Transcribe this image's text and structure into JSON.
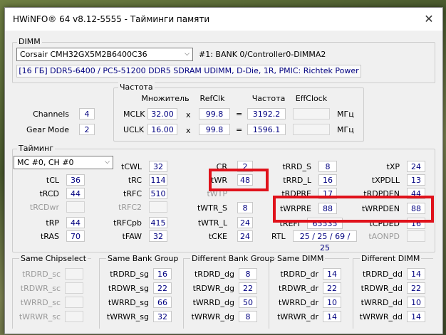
{
  "window": {
    "title": "HWiNFO® 64 v8.12-5555 - Тайминги памяти",
    "close_label": "✕"
  },
  "dimm": {
    "group_label": "DIMM",
    "module": "Corsair CMH32GX5M2B6400C36",
    "slot": "#1: BANK 0/Controller0-DIMMA2",
    "info": "[16 ГБ] DDR5-6400 / PC5-51200 DDR5 SDRAM UDIMM, D-Die, 1R, PMIC: Richtek Power"
  },
  "left_info": {
    "channels_label": "Channels",
    "channels_value": "4",
    "gear_label": "Gear Mode",
    "gear_value": "2"
  },
  "freq": {
    "group_label": "Частота",
    "headers": {
      "multiplier": "Множитель",
      "refclk": "RefClk",
      "freq": "Частота",
      "effclock": "EffClock"
    },
    "mclk": {
      "label": "MCLK",
      "mult": "32.00",
      "x": "x",
      "refclk": "99.8",
      "eq": "=",
      "value": "3192.2",
      "eff": "",
      "unit": "МГц"
    },
    "uclk": {
      "label": "UCLK",
      "mult": "16.00",
      "x": "x",
      "refclk": "99.8",
      "eq": "=",
      "value": "1596.1",
      "eff": "",
      "unit": "МГц"
    }
  },
  "timing": {
    "group_label": "Тайминг",
    "channel_select": "MC #0, CH #0",
    "tCL": {
      "label": "tCL",
      "value": "36"
    },
    "tRCD": {
      "label": "tRCD",
      "value": "44"
    },
    "tRCDwr": {
      "label": "tRCDwr",
      "value": ""
    },
    "tRP": {
      "label": "tRP",
      "value": "44"
    },
    "tRAS": {
      "label": "tRAS",
      "value": "70"
    },
    "tCWL": {
      "label": "tCWL",
      "value": "32"
    },
    "tRC": {
      "label": "tRC",
      "value": "114"
    },
    "tRFC": {
      "label": "tRFC",
      "value": "510"
    },
    "tRFC2": {
      "label": "tRFC2",
      "value": ""
    },
    "tRFCpb": {
      "label": "tRFCpb",
      "value": "415"
    },
    "tFAW": {
      "label": "tFAW",
      "value": "32"
    },
    "CR": {
      "label": "CR",
      "value": "2"
    },
    "tWR": {
      "label": "tWR",
      "value": "48"
    },
    "tWTP": {
      "label": "tWTP"
    },
    "tWTR_S": {
      "label": "tWTR_S",
      "value": "8"
    },
    "tWTR_L": {
      "label": "tWTR_L",
      "value": "24"
    },
    "tCKE": {
      "label": "tCKE",
      "value": "24"
    },
    "tRRD_S": {
      "label": "tRRD_S",
      "value": "8"
    },
    "tRRD_L": {
      "label": "tRRD_L",
      "value": "16"
    },
    "tRDPRE": {
      "label": "tRDPRE",
      "value": "17"
    },
    "tWRPRE": {
      "label": "tWRPRE",
      "value": "88"
    },
    "tREFI": {
      "label": "tREFI",
      "value": "65535"
    },
    "RTL": {
      "label": "RTL",
      "value": "25 / 25 / 69 / 25"
    },
    "tXP": {
      "label": "tXP",
      "value": "24"
    },
    "tXPDLL": {
      "label": "tXPDLL",
      "value": "13"
    },
    "tRDPDEN": {
      "label": "tRDPDEN",
      "value": "44"
    },
    "tWRPDEN": {
      "label": "tWRPDEN",
      "value": "88"
    },
    "tCPDED": {
      "label": "tCPDED",
      "value": "16"
    },
    "tAONPD": {
      "label": "tAONPD",
      "value": ""
    }
  },
  "sections": [
    {
      "title": "Same Chipselect",
      "rows": [
        {
          "label": "tRDRD_sc",
          "value": ""
        },
        {
          "label": "tRDWR_sc",
          "value": ""
        },
        {
          "label": "tWRRD_sc",
          "value": ""
        },
        {
          "label": "tWRWR_sc",
          "value": ""
        }
      ]
    },
    {
      "title": "Same Bank Group",
      "rows": [
        {
          "label": "tRDRD_sg",
          "value": "16"
        },
        {
          "label": "tRDWR_sg",
          "value": "22"
        },
        {
          "label": "tWRRD_sg",
          "value": "66"
        },
        {
          "label": "tWRWR_sg",
          "value": "32"
        }
      ]
    },
    {
      "title": "Different Bank Group",
      "rows": [
        {
          "label": "tRDRD_dg",
          "value": "8"
        },
        {
          "label": "tRDWR_dg",
          "value": "22"
        },
        {
          "label": "tWRRD_dg",
          "value": "50"
        },
        {
          "label": "tWRWR_dg",
          "value": "8"
        }
      ]
    },
    {
      "title": "Same DIMM",
      "rows": [
        {
          "label": "tRDRD_dr",
          "value": "14"
        },
        {
          "label": "tRDWR_dr",
          "value": "22"
        },
        {
          "label": "tWRRD_dr",
          "value": "10"
        },
        {
          "label": "tWRWR_dr",
          "value": "14"
        }
      ]
    },
    {
      "title": "Different DIMM",
      "rows": [
        {
          "label": "tRDRD_dd",
          "value": "14"
        },
        {
          "label": "tRDWR_dd",
          "value": "22"
        },
        {
          "label": "tWRRD_dd",
          "value": "10"
        },
        {
          "label": "tWRWR_dd",
          "value": "14"
        }
      ]
    }
  ],
  "colors": {
    "value_text": "#000080",
    "highlight": "#e0121b"
  }
}
